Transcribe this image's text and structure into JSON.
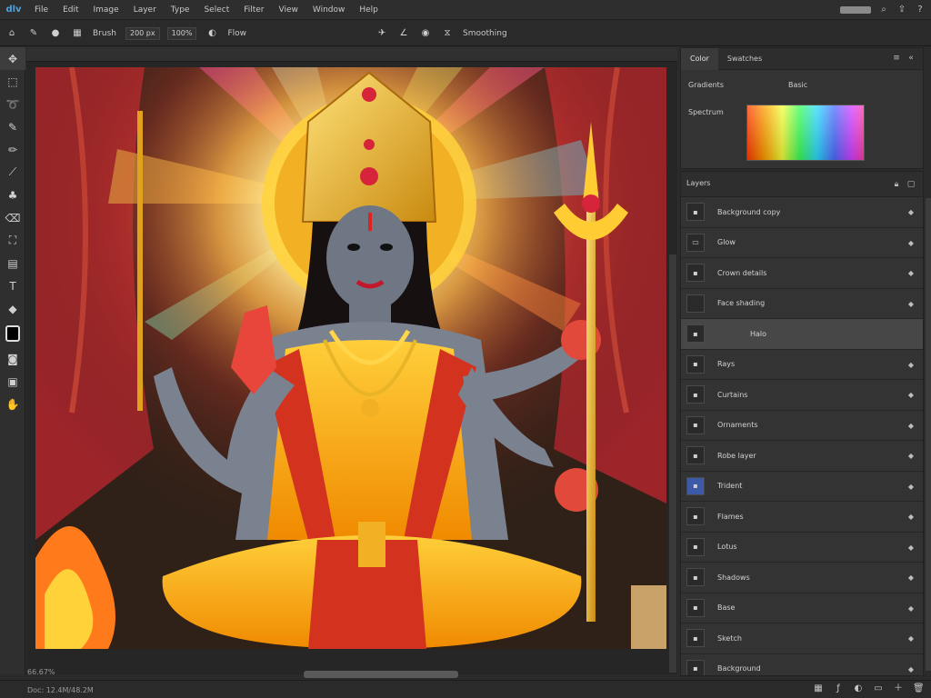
{
  "app": {
    "logo": "dlv"
  },
  "menu": [
    "File",
    "Edit",
    "Image",
    "Layer",
    "Type",
    "Select",
    "Filter",
    "View",
    "Window",
    "Help"
  ],
  "options_bar": {
    "mode_label": "Brush",
    "size_field": "200 px",
    "opacity_field": "100%",
    "flow_label": "Flow",
    "smoothing_label": "Smoothing"
  },
  "tools": [
    {
      "icon": "move-icon",
      "glyph": "✥"
    },
    {
      "icon": "marquee-icon",
      "glyph": "⬚"
    },
    {
      "icon": "lasso-icon",
      "glyph": "➰"
    },
    {
      "icon": "brush-icon",
      "glyph": "✎"
    },
    {
      "icon": "pencil-icon",
      "glyph": "✏"
    },
    {
      "icon": "eyedropper-icon",
      "glyph": "⟋"
    },
    {
      "icon": "clone-stamp-icon",
      "glyph": "♣"
    },
    {
      "icon": "eraser-icon",
      "glyph": "⌫"
    },
    {
      "icon": "bucket-icon",
      "glyph": "⛶"
    },
    {
      "icon": "gradient-icon",
      "glyph": "▤"
    },
    {
      "icon": "text-icon",
      "glyph": "T"
    },
    {
      "icon": "shape-icon",
      "glyph": "◆"
    }
  ],
  "tools_bottom": [
    {
      "icon": "quick-mask-icon",
      "glyph": "◙"
    },
    {
      "icon": "screen-mode-icon",
      "glyph": "▣"
    },
    {
      "icon": "hand-icon",
      "glyph": "✋"
    }
  ],
  "color_panel": {
    "tabs": [
      "Color",
      "Swatches"
    ],
    "label_a": "Gradients",
    "label_b": "Basic",
    "preset_label": "Spectrum"
  },
  "layers_panel": {
    "title": "Layers",
    "layers": [
      {
        "name": "Background copy",
        "thumb": "▪",
        "selected": false,
        "blue": false
      },
      {
        "name": "Glow",
        "thumb": "▭",
        "selected": false,
        "blue": false
      },
      {
        "name": "Crown details",
        "thumb": "▪",
        "selected": false,
        "blue": false
      },
      {
        "name": "Face shading",
        "thumb": "",
        "selected": false,
        "blue": false
      },
      {
        "name": "Halo",
        "thumb": "▪",
        "selected": true,
        "blue": false
      },
      {
        "name": "Rays",
        "thumb": "▪",
        "selected": false,
        "blue": false
      },
      {
        "name": "Curtains",
        "thumb": "▪",
        "selected": false,
        "blue": false
      },
      {
        "name": "Ornaments",
        "thumb": "▪",
        "selected": false,
        "blue": false
      },
      {
        "name": "Robe layer",
        "thumb": "▪",
        "selected": false,
        "blue": false
      },
      {
        "name": "Trident",
        "thumb": "▪",
        "selected": false,
        "blue": true
      },
      {
        "name": "Flames",
        "thumb": "▪",
        "selected": false,
        "blue": false
      },
      {
        "name": "Lotus",
        "thumb": "▪",
        "selected": false,
        "blue": false
      },
      {
        "name": "Shadows",
        "thumb": "▪",
        "selected": false,
        "blue": false
      },
      {
        "name": "Base",
        "thumb": "▪",
        "selected": false,
        "blue": false
      },
      {
        "name": "Sketch",
        "thumb": "▪",
        "selected": false,
        "blue": false
      },
      {
        "name": "Background",
        "thumb": "▪",
        "selected": false,
        "blue": false
      }
    ]
  },
  "status": {
    "zoom": "66.67%",
    "doc": "Doc: 12.4M/48.2M"
  }
}
